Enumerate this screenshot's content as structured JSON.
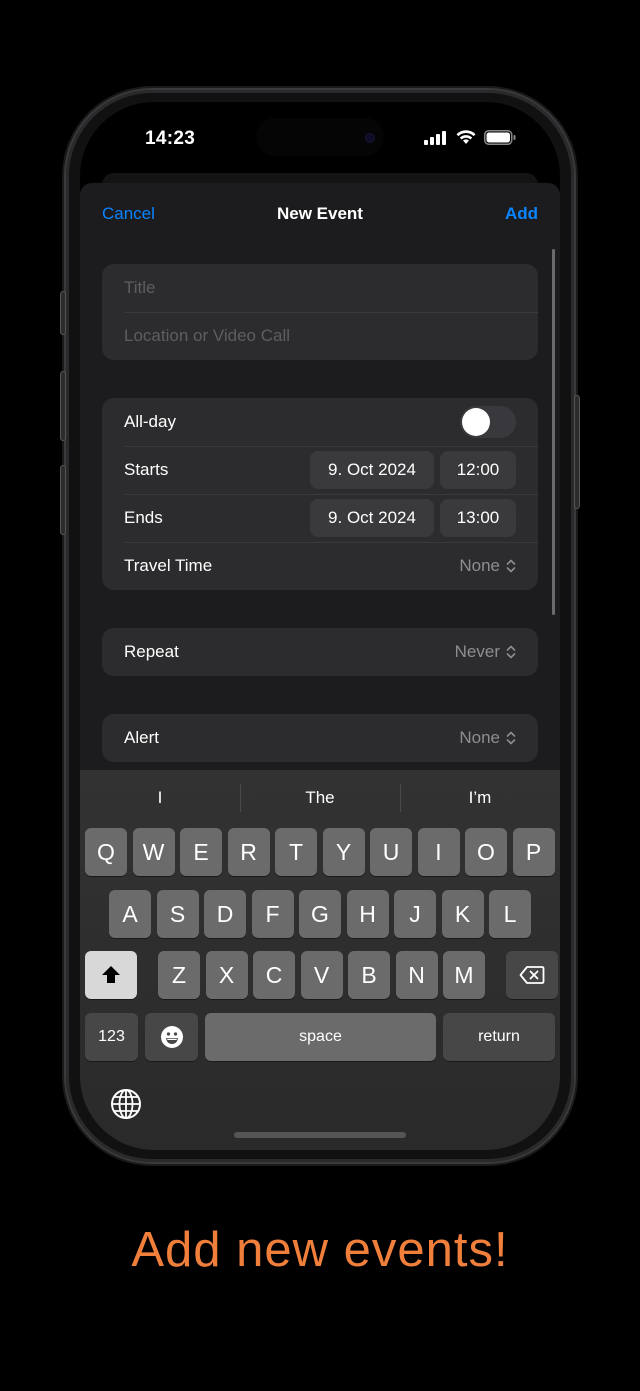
{
  "status_bar": {
    "time": "14:23",
    "icons": [
      "cellular-signal-icon",
      "wifi-icon",
      "battery-icon"
    ]
  },
  "nav": {
    "cancel_label": "Cancel",
    "title": "New Event",
    "add_label": "Add"
  },
  "accent_color": "#0a84ff",
  "fields": {
    "title_placeholder": "Title",
    "location_placeholder": "Location or Video Call"
  },
  "schedule": {
    "all_day": {
      "label": "All-day",
      "on": false
    },
    "starts": {
      "label": "Starts",
      "date": "9. Oct 2024",
      "time": "12:00"
    },
    "ends": {
      "label": "Ends",
      "date": "9. Oct 2024",
      "time": "13:00"
    },
    "travel_time": {
      "label": "Travel Time",
      "value": "None"
    }
  },
  "repeat": {
    "label": "Repeat",
    "value": "Never"
  },
  "alert": {
    "label": "Alert",
    "value": "None"
  },
  "keyboard": {
    "suggestions": [
      "I",
      "The",
      "I’m"
    ],
    "row1": [
      "Q",
      "W",
      "E",
      "R",
      "T",
      "Y",
      "U",
      "I",
      "O",
      "P"
    ],
    "row2": [
      "A",
      "S",
      "D",
      "F",
      "G",
      "H",
      "J",
      "K",
      "L"
    ],
    "row3": [
      "Z",
      "X",
      "C",
      "V",
      "B",
      "N",
      "M"
    ],
    "numbers_label": "123",
    "space_label": "space",
    "return_label": "return"
  },
  "tagline": "Add new events!",
  "tagline_color": "#f07f3c"
}
